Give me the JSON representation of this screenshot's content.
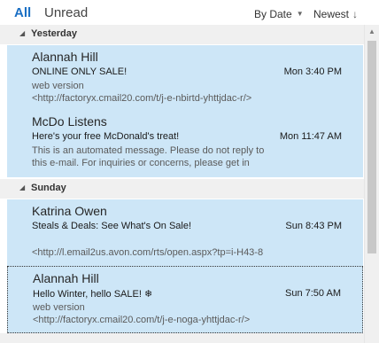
{
  "tabs": {
    "all": "All",
    "unread": "Unread"
  },
  "sort": {
    "by": "By Date",
    "order": "Newest"
  },
  "groups": [
    {
      "title": "Yesterday",
      "messages": [
        {
          "from": "Alannah Hill",
          "subject": "ONLINE ONLY SALE!",
          "date": "Mon 3:40 PM",
          "preview1": "web version",
          "preview2": "<http://factoryx.cmail20.com/t/j-e-nbirtd-yhttjdac-r/>"
        },
        {
          "from": "McDo Listens",
          "subject": "Here's your free McDonald's treat!",
          "date": "Mon 11:47 AM",
          "preview1": "This is an automated message. Please do not reply to",
          "preview2": "this e-mail. For inquiries or concerns, please get in"
        }
      ]
    },
    {
      "title": "Sunday",
      "messages": [
        {
          "from": "Katrina Owen",
          "subject": "Steals & Deals: See What's On Sale!",
          "date": "Sun 8:43 PM",
          "preview1": "",
          "preview2": "<http://l.email2us.avon.com/rts/open.aspx?tp=i-H43-8"
        },
        {
          "from": "Alannah Hill",
          "subject": "Hello Winter, hello SALE! ❄",
          "date": "Sun 7:50 AM",
          "preview1": "web version",
          "preview2": "<http://factoryx.cmail20.com/t/j-e-noga-yhttjdac-r/>"
        }
      ]
    }
  ],
  "icons": {
    "sort_by": "caret-down-icon",
    "sort_order": "arrow-down-icon",
    "group_toggle": "collapse-triangle-icon",
    "scroll_up": "scroll-up-arrow-icon"
  },
  "colors": {
    "accent": "#1a6fc4",
    "selected_row": "#cde6f7",
    "group_header": "#f0f0f0"
  }
}
